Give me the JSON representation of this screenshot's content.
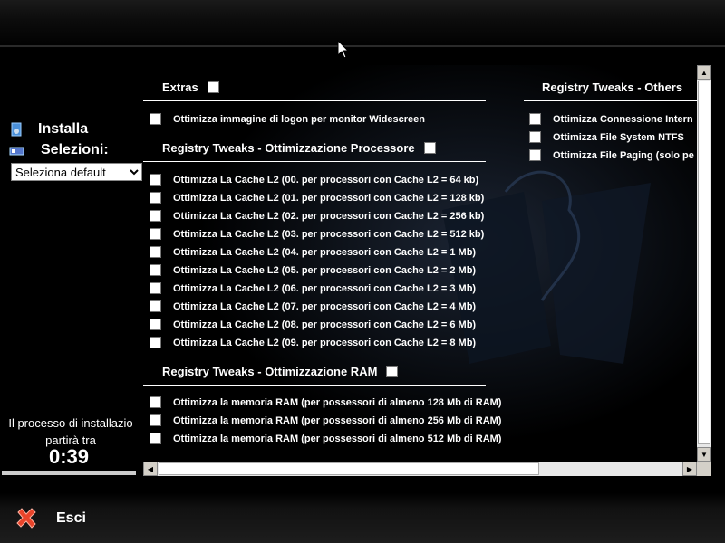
{
  "sidebar": {
    "install_label": "Installa",
    "selections_label": "Selezioni:",
    "preset_select": {
      "selected": "Seleziona default"
    },
    "countdown_text_line1": "Il processo di installazio",
    "countdown_text_line2": "partirà tra",
    "timer": "0:39",
    "progress_fraction": 1.0
  },
  "sections": {
    "extras": {
      "title": "Extras",
      "options": [
        "Ottimizza immagine di logon per monitor Widescreen"
      ]
    },
    "processor": {
      "title": "Registry Tweaks - Ottimizzazione Processore",
      "options": [
        "Ottimizza La Cache L2 (00. per processori con Cache L2 = 64 kb)",
        "Ottimizza La Cache L2 (01. per processori con Cache L2 = 128 kb)",
        "Ottimizza La Cache L2 (02. per processori con Cache L2 = 256 kb)",
        "Ottimizza La Cache L2 (03. per processori con Cache L2 = 512 kb)",
        "Ottimizza La Cache L2 (04. per processori con Cache L2 = 1 Mb)",
        "Ottimizza La Cache L2 (05. per processori con Cache L2 = 2 Mb)",
        "Ottimizza La Cache L2 (06. per processori con Cache L2 = 3 Mb)",
        "Ottimizza La Cache L2 (07. per processori con Cache L2 = 4 Mb)",
        "Ottimizza La Cache L2 (08. per processori con Cache L2 = 6 Mb)",
        "Ottimizza La Cache L2 (09. per processori con Cache L2 = 8 Mb)"
      ]
    },
    "ram": {
      "title": "Registry Tweaks - Ottimizzazione RAM",
      "options": [
        "Ottimizza la memoria RAM (per possessori di almeno 128 Mb di RAM)",
        "Ottimizza la memoria RAM (per possessori di almeno 256 Mb di RAM)",
        "Ottimizza la memoria RAM (per possessori di almeno 512 Mb di RAM)"
      ]
    },
    "others": {
      "title": "Registry Tweaks - Others",
      "options": [
        "Ottimizza Connessione Intern",
        "Ottimizza File System NTFS",
        "Ottimizza File Paging (solo pe"
      ]
    }
  },
  "footer": {
    "exit_label": "Esci"
  },
  "colors": {
    "background": "#000000",
    "text": "#ffffff",
    "exit_icon": "#e8442a"
  },
  "icons": [
    "install-icon",
    "selections-icon",
    "exit-x-icon",
    "mouse-cursor-icon"
  ]
}
